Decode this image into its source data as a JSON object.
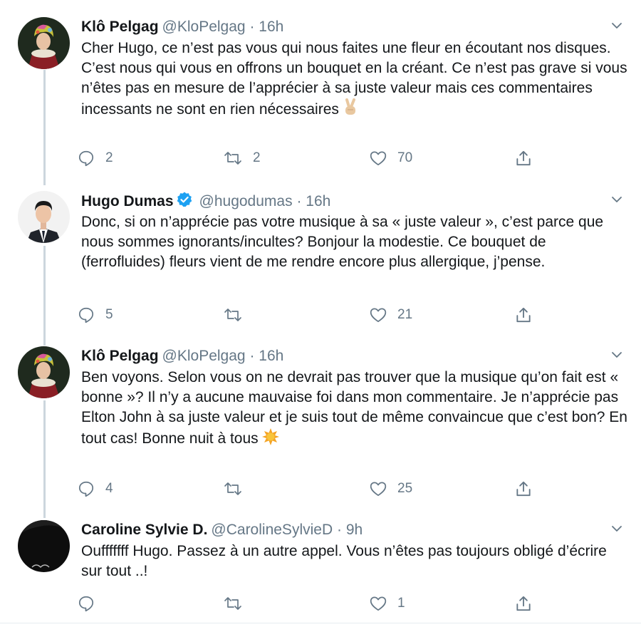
{
  "tweets": [
    {
      "name": "Klô Pelgag",
      "handle": "@KloPelgag",
      "separator": "·",
      "time": "16h",
      "verified": false,
      "text": "Cher Hugo, ce n’est pas vous qui nous faites une fleur en écoutant nos disques. C’est nous qui vous en offrons un bouquet en la créant. Ce n’est pas grave si vous n’êtes pas en mesure de l’apprécier à sa juste valeur mais ces commentaires incessants ne sont en rien nécessaires",
      "emoji": "victory-hand-icon",
      "replies": "2",
      "retweets": "2",
      "likes": "70"
    },
    {
      "name": "Hugo Dumas",
      "handle": "@hugodumas",
      "separator": "·",
      "time": "16h",
      "verified": true,
      "text": "Donc, si on n’apprécie pas votre musique à sa « juste valeur », c’est parce que nous sommes ignorants/incultes? Bonjour la modestie. Ce bouquet de (ferrofluides) fleurs vient de me rendre encore plus allergique, j’pense.",
      "replies": "5",
      "retweets": "",
      "likes": "21"
    },
    {
      "name": "Klô Pelgag",
      "handle": "@KloPelgag",
      "separator": "·",
      "time": "16h",
      "verified": false,
      "text": "Ben voyons. Selon vous on ne devrait pas trouver que la musique qu’on fait est « bonne »? Il n’y a aucune mauvaise foi dans mon commentaire. Je n’apprécie pas Elton John à sa juste valeur et je suis tout de même convaincue que c’est bon? En tout cas! Bonne nuit à tous",
      "emoji": "sun-icon",
      "replies": "4",
      "retweets": "",
      "likes": "25"
    },
    {
      "name": "Caroline Sylvie D.",
      "handle": "@CarolineSylvieD",
      "separator": "·",
      "time": "9h",
      "verified": false,
      "text": "Oufffffff Hugo. Passez à un autre appel. Vous n’êtes pas toujours obligé d’écrire sur tout ..!",
      "replies": "",
      "retweets": "",
      "likes": "1"
    }
  ],
  "colors": {
    "text": "#14171a",
    "secondary": "#657786",
    "thread_line": "#ccd6dd",
    "verified": "#1da1f2",
    "divider": "#e6ecf0"
  }
}
